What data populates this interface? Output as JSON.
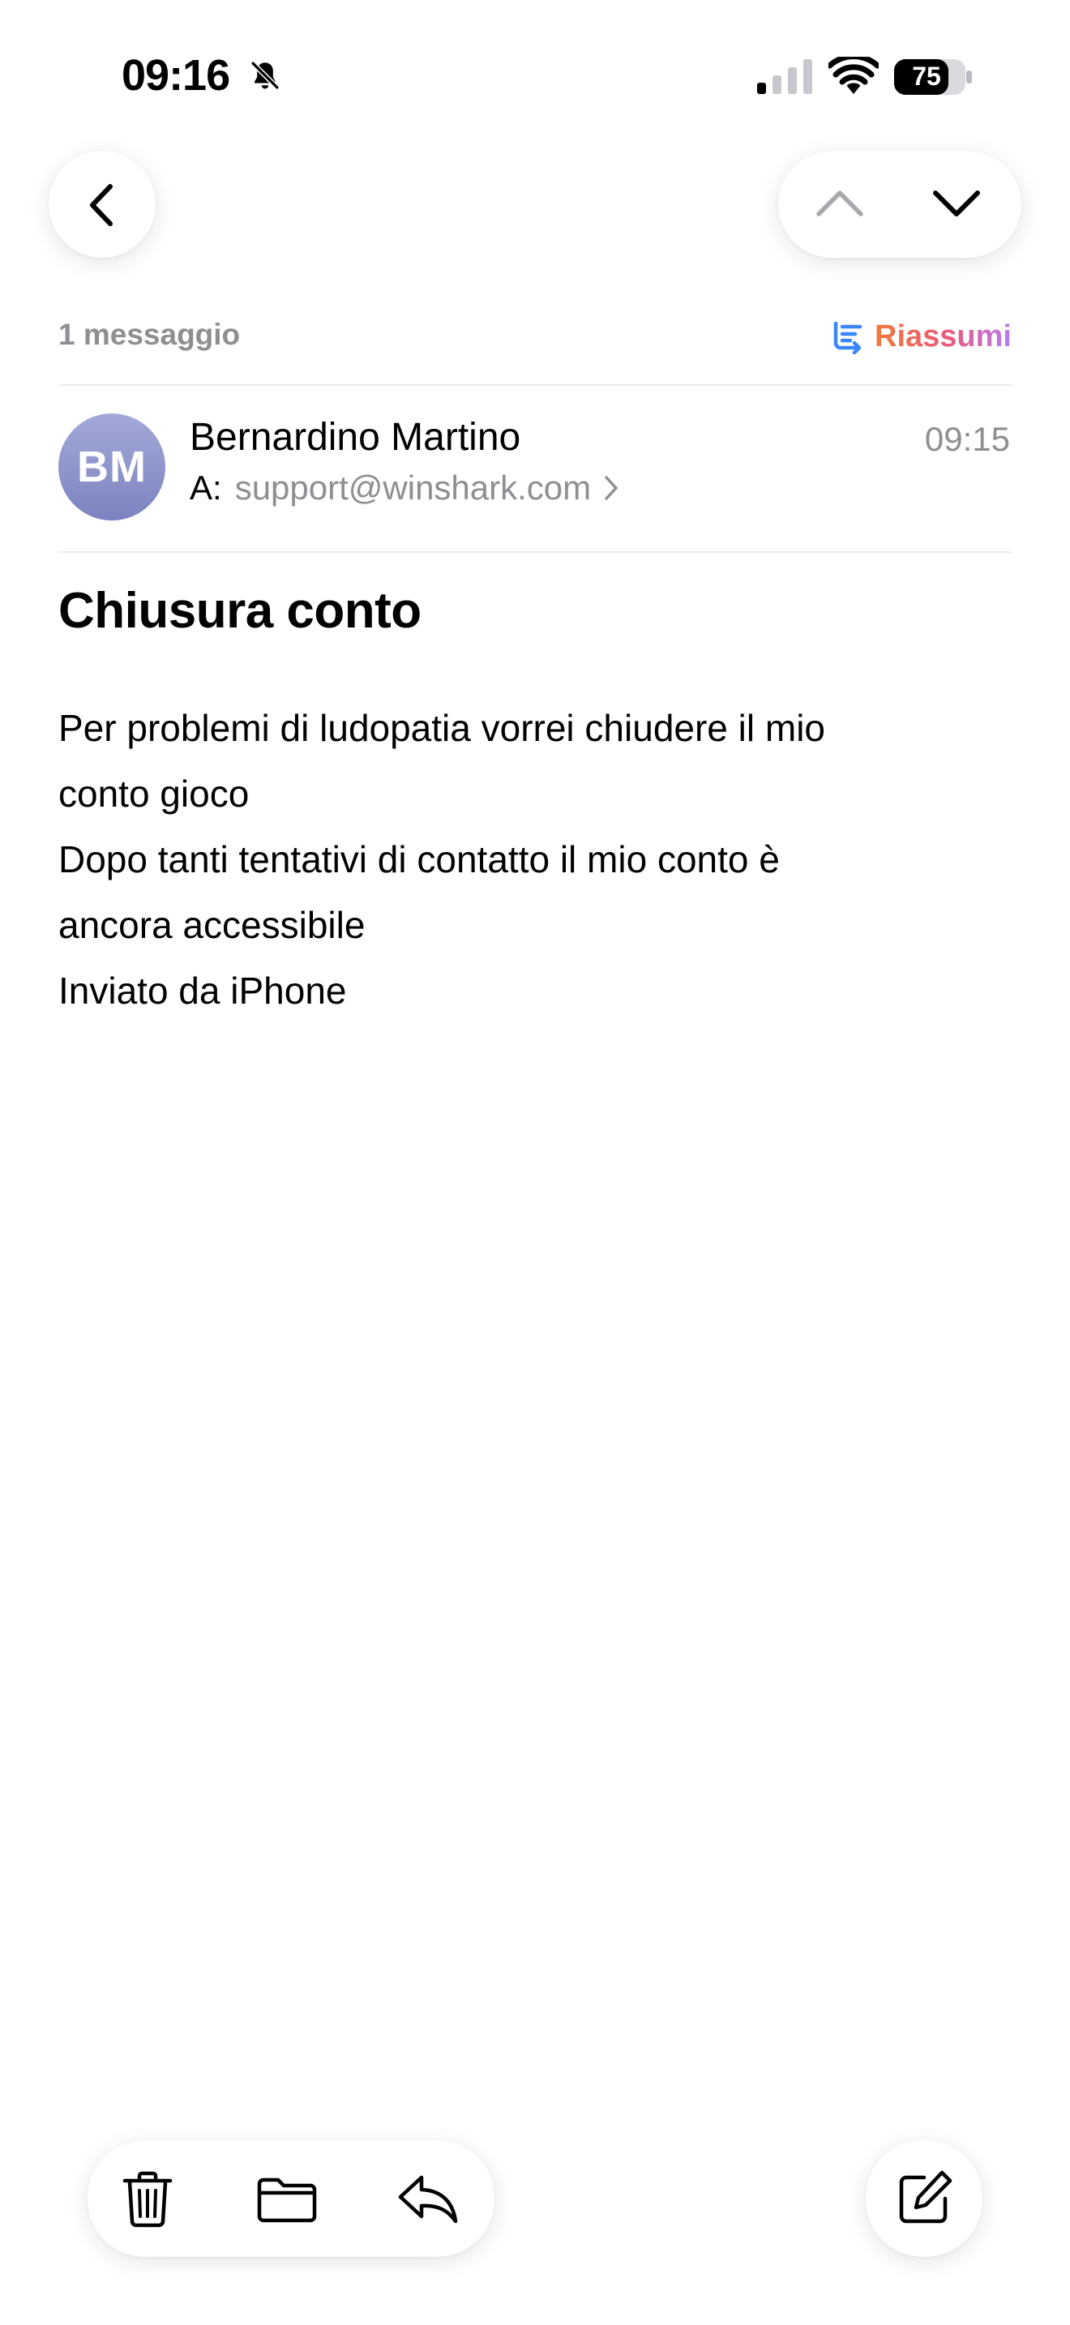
{
  "status_bar": {
    "time": "09:16",
    "battery_level": "75",
    "icons": [
      "bell-slash-icon",
      "cellular-signal-icon",
      "wifi-icon",
      "battery-icon"
    ]
  },
  "nav": {
    "back_icon": "chevron-left-icon",
    "prev_icon": "chevron-up-icon",
    "next_icon": "chevron-down-icon"
  },
  "thread": {
    "message_count": "1 messaggio",
    "summarize_label": "Riassumi"
  },
  "email": {
    "avatar_initials": "BM",
    "sender": "Bernardino Martino",
    "time": "09:15",
    "to_label": "A:",
    "recipient": "support@winshark.com",
    "subject": "Chiusura conto",
    "body_lines": [
      "Per problemi di ludopatia vorrei chiudere il mio",
      "conto gioco",
      "Dopo tanti tentativi di contatto il mio conto è",
      "ancora accessibile",
      "Inviato da iPhone"
    ]
  },
  "toolbar": {
    "icons": [
      "trash-icon",
      "folder-icon",
      "reply-icon",
      "compose-icon"
    ]
  },
  "colors": {
    "secondary_text": "#8e8e93",
    "avatar_top": "#a3aad8",
    "avatar_bottom": "#7b83bf",
    "summarize_gradient": [
      "#f07a3a",
      "#ea5a7e",
      "#b77df0"
    ],
    "summarize_icon": "#3a86ff"
  }
}
